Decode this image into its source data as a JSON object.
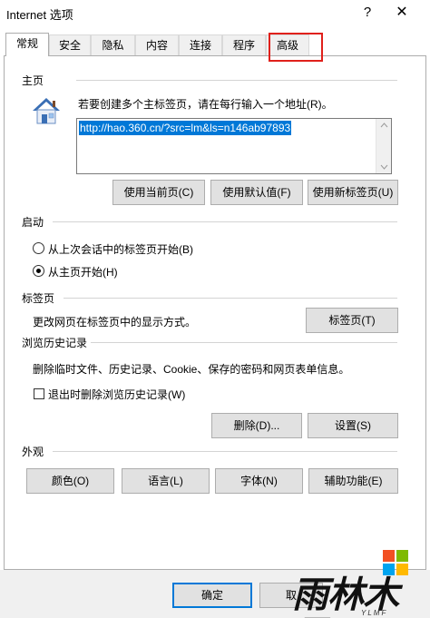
{
  "window": {
    "title": "Internet 选项",
    "help_label": "?",
    "close_label": "✕"
  },
  "tabs": [
    {
      "label": "常规",
      "active": true
    },
    {
      "label": "安全"
    },
    {
      "label": "隐私"
    },
    {
      "label": "内容"
    },
    {
      "label": "连接"
    },
    {
      "label": "程序"
    },
    {
      "label": "高级"
    }
  ],
  "homepage": {
    "section_label": "主页",
    "description": "若要创建多个主标签页，请在每行输入一个地址(R)。",
    "url": "http://hao.360.cn/?src=lm&ls=n146ab97893",
    "icon": "house-icon",
    "use_current_label": "使用当前页(C)",
    "use_default_label": "使用默认值(F)",
    "use_new_tab_label": "使用新标签页(U)"
  },
  "startup": {
    "section_label": "启动",
    "option_last_session": "从上次会话中的标签页开始(B)",
    "option_homepage": "从主页开始(H)",
    "selected": "homepage"
  },
  "tabs_section": {
    "section_label": "标签页",
    "description": "更改网页在标签页中的显示方式。",
    "button_label": "标签页(T)"
  },
  "history": {
    "section_label": "浏览历史记录",
    "description": "删除临时文件、历史记录、Cookie、保存的密码和网页表单信息。",
    "delete_on_exit_label": "退出时删除浏览历史记录(W)",
    "delete_on_exit_checked": false,
    "delete_label": "删除(D)...",
    "settings_label": "设置(S)"
  },
  "appearance": {
    "section_label": "外观",
    "colors_label": "颜色(O)",
    "languages_label": "语言(L)",
    "fonts_label": "字体(N)",
    "accessibility_label": "辅助功能(E)"
  },
  "footer": {
    "ok_label": "确定",
    "cancel_label": "取"
  },
  "watermark": {
    "text": "雨林木风",
    "sub": "YLMF"
  },
  "colors": {
    "highlight": "#e0201b",
    "selection": "#0078d7"
  }
}
